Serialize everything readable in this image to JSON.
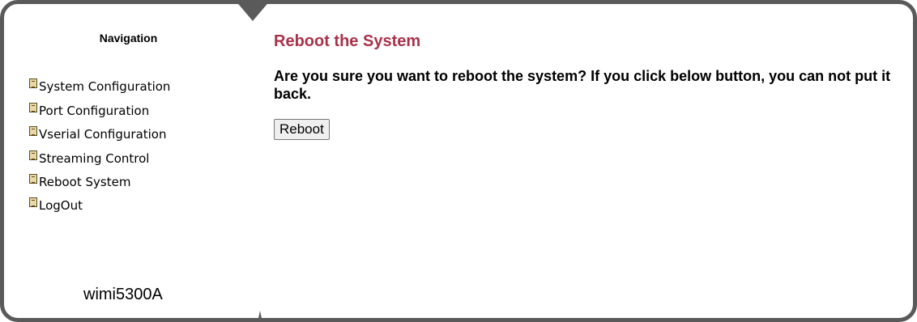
{
  "sidebar": {
    "title": "Navigation",
    "items": [
      {
        "label": "System Configuration",
        "icon": "document-icon"
      },
      {
        "label": "Port Configuration",
        "icon": "document-icon"
      },
      {
        "label": "Vserial Configuration",
        "icon": "document-icon"
      },
      {
        "label": "Streaming Control",
        "icon": "document-icon"
      },
      {
        "label": "Reboot System",
        "icon": "document-icon"
      },
      {
        "label": "LogOut",
        "icon": "document-icon"
      }
    ],
    "device_name": "wimi5300A"
  },
  "main": {
    "title": "Reboot the System",
    "message": "Are you sure you want to reboot the system? If you click below button, you can not put it back.",
    "button_label": "Reboot"
  },
  "colors": {
    "title": "#a8324a",
    "frame": "#5a5a5a"
  }
}
